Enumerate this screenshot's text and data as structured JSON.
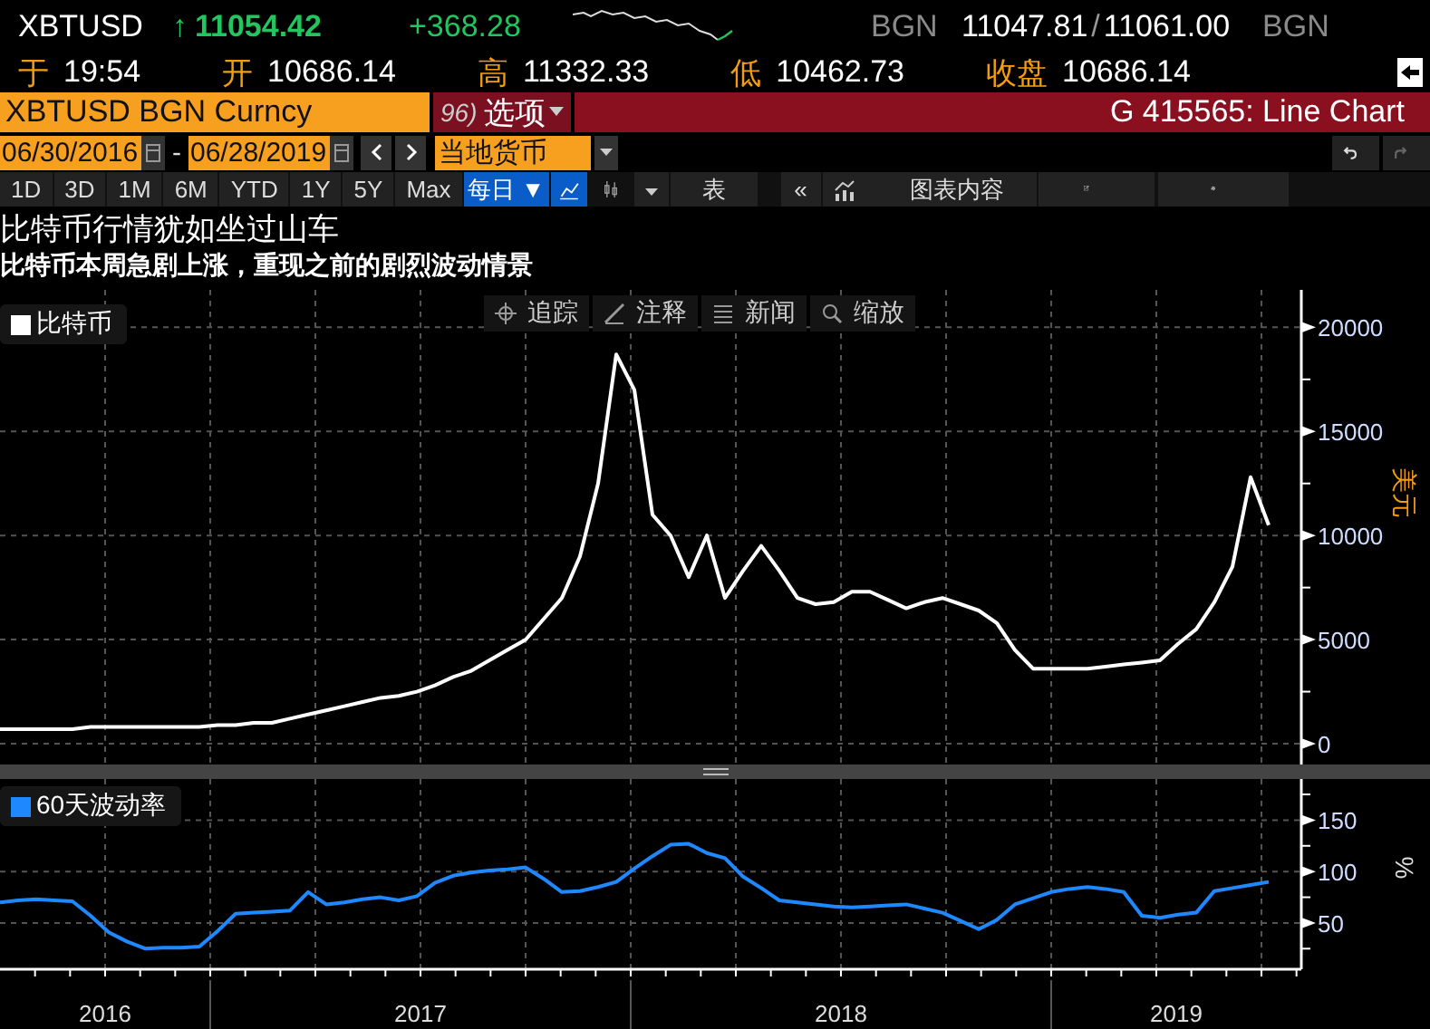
{
  "quote": {
    "ticker": "XBTUSD",
    "arrow": "↑",
    "last": "11054.42",
    "change": "+368.28",
    "source_left": "BGN",
    "bid": "11047.81",
    "separator": "/",
    "ask": "11061.00",
    "source_right": "BGN"
  },
  "stats": [
    {
      "label": "于",
      "value": "19:54"
    },
    {
      "label": "开",
      "value": "10686.14"
    },
    {
      "label": "高",
      "value": "11332.33"
    },
    {
      "label": "低",
      "value": "10462.73"
    },
    {
      "label": "收盘",
      "value": "10686.14"
    }
  ],
  "security_bar": {
    "security": "XBTUSD BGN Curncy",
    "menu_number": "96)",
    "menu_label": "选项",
    "title": "G 415565: Line Chart"
  },
  "date_range": {
    "start": "06/30/2016",
    "dash": "-",
    "end": "06/28/2019",
    "currency": "当地货币"
  },
  "periods": [
    "1D",
    "3D",
    "1M",
    "6M",
    "YTD",
    "1Y",
    "5Y",
    "Max"
  ],
  "frequency": "每日 ▼",
  "chart_types": [
    {
      "kind": "line",
      "selected": true
    },
    {
      "kind": "candle",
      "selected": false
    }
  ],
  "table_button": "表",
  "collapse_button": "«",
  "chart_content_button": "图表内容",
  "headline": "比特币行情犹如坐过山车",
  "subheadline": "比特币本周急剧上涨，重现之前的剧烈波动情景",
  "chart_tools": [
    {
      "kind": "crosshair",
      "label": "追踪"
    },
    {
      "kind": "pencil",
      "label": "注释"
    },
    {
      "kind": "lines",
      "label": "新闻"
    },
    {
      "kind": "magnifier",
      "label": "缩放"
    }
  ],
  "price_panel": {
    "chart_data": {
      "type": "line",
      "ylabel": "美元",
      "grid": true,
      "ylim": [
        -1000,
        21800
      ],
      "yticks": [
        0,
        5000,
        10000,
        15000,
        20000
      ],
      "series": [
        {
          "name": "比特币",
          "color": "#ffffff",
          "values": [
            700,
            700,
            700,
            700,
            700,
            800,
            800,
            800,
            800,
            800,
            800,
            800,
            900,
            900,
            1000,
            1000,
            1200,
            1400,
            1600,
            1800,
            2000,
            2200,
            2300,
            2500,
            2800,
            3200,
            3500,
            4000,
            4500,
            5000,
            6000,
            7000,
            9000,
            12500,
            18700,
            17000,
            11000,
            10000,
            8000,
            10000,
            7000,
            8300,
            9500,
            8300,
            7000,
            6700,
            6800,
            7300,
            7300,
            6900,
            6500,
            6800,
            7000,
            6700,
            6400,
            5800,
            4500,
            3600,
            3600,
            3600,
            3600,
            3700,
            3800,
            3900,
            4000,
            4800,
            5500,
            6800,
            8500,
            12800,
            10500
          ]
        }
      ]
    }
  },
  "volatility_panel": {
    "chart_data": {
      "type": "line",
      "ylabel": "%",
      "grid": true,
      "ylim": [
        5,
        190
      ],
      "yticks": [
        50,
        100,
        150
      ],
      "series": [
        {
          "name": "60天波动率",
          "color": "#1e88ff",
          "values": [
            70,
            72,
            73,
            72,
            71,
            57,
            41,
            32,
            25,
            26,
            26,
            27,
            42,
            59,
            60,
            61,
            62,
            80,
            68,
            70,
            73,
            75,
            72,
            76,
            89,
            96,
            99,
            101,
            102,
            104,
            93,
            80,
            81,
            85,
            90,
            103,
            115,
            126,
            127,
            118,
            113,
            95,
            84,
            72,
            70,
            68,
            66,
            65,
            66,
            67,
            68,
            64,
            60,
            52,
            44,
            53,
            68,
            74,
            80,
            83,
            85,
            83,
            80,
            57,
            55,
            58,
            60,
            81,
            84,
            87,
            90
          ]
        }
      ]
    }
  },
  "years": [
    "2016",
    "2017",
    "2018",
    "2019"
  ]
}
